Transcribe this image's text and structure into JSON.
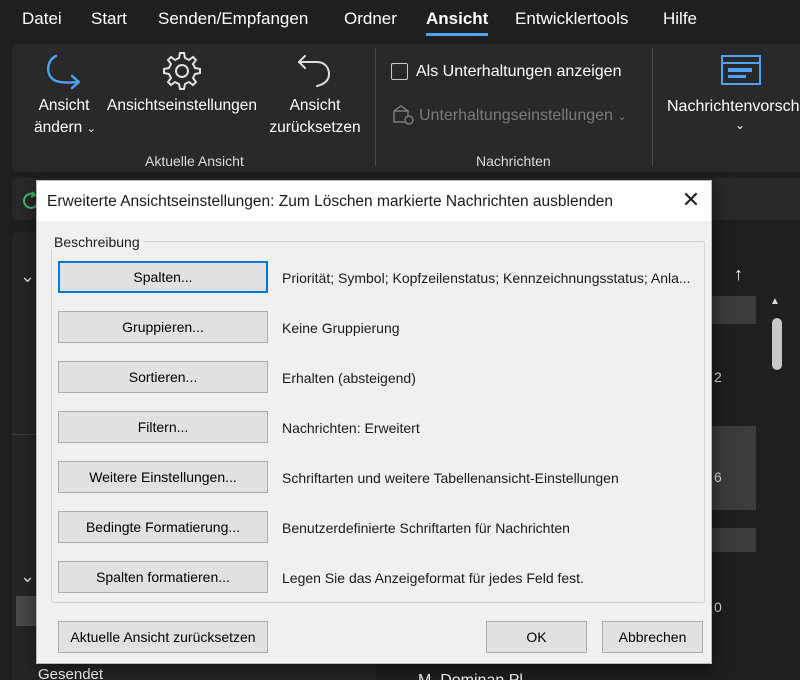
{
  "menubar": {
    "items": [
      "Datei",
      "Start",
      "Senden/Empfangen",
      "Ordner",
      "Ansicht",
      "Entwicklertools",
      "Hilfe"
    ],
    "active": "Ansicht"
  },
  "ribbon": {
    "change_view": {
      "line1": "Ansicht",
      "line2": "ändern"
    },
    "view_settings": "Ansichtseinstellungen",
    "reset_view": {
      "line1": "Ansicht",
      "line2": "zurücksetzen"
    },
    "group_current_view": "Aktuelle Ansicht",
    "show_conversations": "Als Unterhaltungen anzeigen",
    "conversation_settings": "Unterhaltungseinstellungen",
    "group_messages": "Nachrichten",
    "message_preview": "Nachrichtenvorscha"
  },
  "background": {
    "sent_folder": "Gesendet",
    "numbers": [
      "2",
      "6",
      "0"
    ],
    "bottom_message": "M. Dominan Pl"
  },
  "dialog": {
    "title": "Erweiterte Ansichtseinstellungen: Zum Löschen markierte Nachrichten ausblenden",
    "group_label": "Beschreibung",
    "rows": [
      {
        "button": "Spalten...",
        "description": "Priorität; Symbol; Kopfzeilenstatus; Kennzeichnungsstatus; Anla..."
      },
      {
        "button": "Gruppieren...",
        "description": "Keine Gruppierung"
      },
      {
        "button": "Sortieren...",
        "description": "Erhalten (absteigend)"
      },
      {
        "button": "Filtern...",
        "description": "Nachrichten: Erweitert"
      },
      {
        "button": "Weitere Einstellungen...",
        "description": "Schriftarten und weitere Tabellenansicht-Einstellungen"
      },
      {
        "button": "Bedingte Formatierung...",
        "description": "Benutzerdefinierte Schriftarten für Nachrichten"
      },
      {
        "button": "Spalten formatieren...",
        "description": "Legen Sie das Anzeigeformat für jedes Feld fest."
      }
    ],
    "reset_button": "Aktuelle Ansicht zurücksetzen",
    "ok_button": "OK",
    "cancel_button": "Abbrechen",
    "close_glyph": "✕"
  },
  "colors": {
    "accent": "#4fa3f7",
    "focus_border": "#0078d7",
    "dialog_bg": "#f0f0f0",
    "app_bg": "#1f1f1f"
  }
}
